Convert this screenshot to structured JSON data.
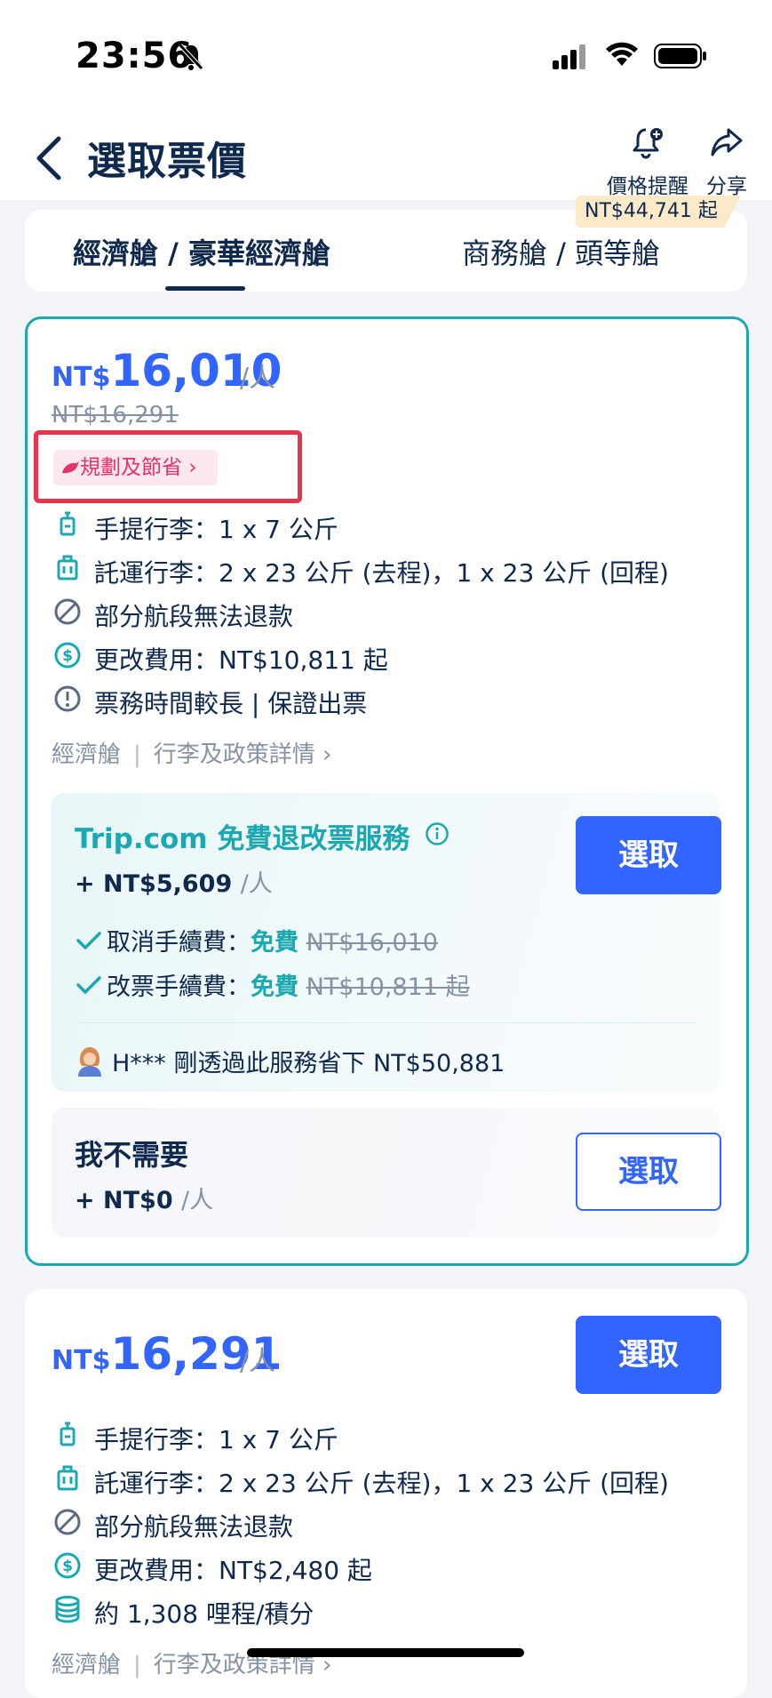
{
  "status_bar": {
    "time": "23:56"
  },
  "nav": {
    "title": "選取票價",
    "price_alert_label": "價格提醒",
    "share_label": "分享"
  },
  "tabs": {
    "economy": "經濟艙 / 豪華經濟艙",
    "business": "商務艙 / 頭等艙",
    "business_price_tag": "NT$44,741 起"
  },
  "fare1": {
    "currency": "NT$",
    "price": "16,010",
    "per": "/人",
    "original_price": "NT$16,291",
    "plan_badge": "規劃及節省",
    "features": [
      {
        "icon": "carry-on-icon",
        "text": "手提行李：1 x 7 公斤"
      },
      {
        "icon": "checked-bag-icon",
        "text": "託運行李：2 x 23 公斤 (去程)，1 x 23 公斤 (回程)"
      },
      {
        "icon": "no-refund-icon",
        "text": "部分航段無法退款"
      },
      {
        "icon": "dollar-icon",
        "text": "更改費用：NT$10,811 起"
      },
      {
        "icon": "alert-icon",
        "text": "票務時間較長 | 保證出票"
      }
    ],
    "cabin": "經濟艙",
    "policy_link": "行李及政策詳情",
    "service": {
      "title": "Trip.com 免費退改票服務",
      "price": "+ NT$5,609",
      "per": "/人",
      "select_label": "選取",
      "checks": [
        {
          "label": "取消手續費：",
          "free": "免費",
          "old": "NT$16,010"
        },
        {
          "label": "改票手續費：",
          "free": "免費",
          "old": "NT$10,811 起"
        }
      ],
      "testimonial": "H*** 剛透過此服務省下 NT$50,881"
    },
    "no_need": {
      "title": "我不需要",
      "price": "+ NT$0",
      "per": "/人",
      "select_label": "選取"
    }
  },
  "fare2": {
    "currency": "NT$",
    "price": "16,291",
    "per": "/人",
    "select_label": "選取",
    "features": [
      {
        "icon": "carry-on-icon",
        "text": "手提行李：1 x 7 公斤"
      },
      {
        "icon": "checked-bag-icon",
        "text": "託運行李：2 x 23 公斤 (去程)，1 x 23 公斤 (回程)"
      },
      {
        "icon": "no-refund-icon",
        "text": "部分航段無法退款"
      },
      {
        "icon": "dollar-icon",
        "text": "更改費用：NT$2,480 起"
      },
      {
        "icon": "coins-icon",
        "text": "約 1,308 哩程/積分"
      }
    ],
    "cabin": "經濟艙",
    "policy_link": "行李及政策詳情"
  },
  "colors": {
    "primary": "#3264ff",
    "teal": "#1ca8b0",
    "text": "#0f294d",
    "muted": "#8592a6",
    "highlight": "#e8334d"
  }
}
